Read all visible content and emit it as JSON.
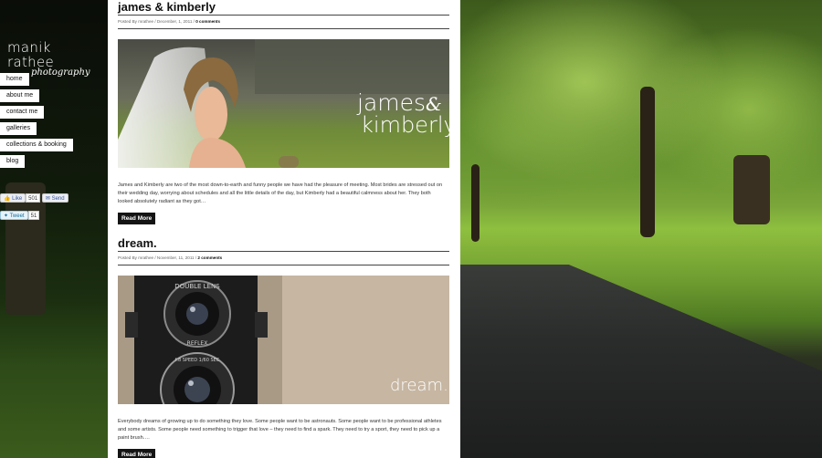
{
  "site": {
    "logo_main": "manik rathee",
    "logo_sub": "photography"
  },
  "nav": {
    "items": [
      {
        "label": "home"
      },
      {
        "label": "about me"
      },
      {
        "label": "contact me"
      },
      {
        "label": "galleries"
      },
      {
        "label": "collections & booking"
      },
      {
        "label": "blog"
      }
    ]
  },
  "social": {
    "like_label": "Like",
    "like_count": "501",
    "send_label": "Send",
    "tweet_label": "Tweet",
    "tweet_count": "51"
  },
  "posts": [
    {
      "title": "james & kimberly",
      "meta_prefix": "Posted By mrathee / December, 1, 2011 / ",
      "comments": "0 comments",
      "image_caption_1": "james",
      "image_caption_amp": "&",
      "image_caption_2": "kimberly",
      "excerpt": "James and Kimberly are two of the most down-to-earth and funny people we have had the pleasure of meeting. Most brides are stressed out on their wedding day, worrying about schedules and all the little details of the day, but Kimberly had a beautiful calmness about her. They both looked absolutely radiant as they got…",
      "read_more": "Read More"
    },
    {
      "title": "dream.",
      "meta_prefix": "Posted By mrathee / November, 11, 2011 / ",
      "comments": "2 comments",
      "image_caption_1": "dream.",
      "camera_text_1": "DOUBLE LENS",
      "camera_text_2": "REFLEX",
      "camera_text_3": "f:8 SPEED 1/60 SEC",
      "excerpt": "Everybody dreams of growing up to do something they love. Some people want to be astronauts. Some people want to be professional athletes and some artists. Some people need something to trigger that love – they need to find a spark. They need to try a sport, they need to pick up a paint brush….",
      "read_more": "Read More"
    }
  ],
  "colors": {
    "content_bg": "#ffffff",
    "button_bg": "#141414",
    "nav_bg": "#ffffff"
  }
}
